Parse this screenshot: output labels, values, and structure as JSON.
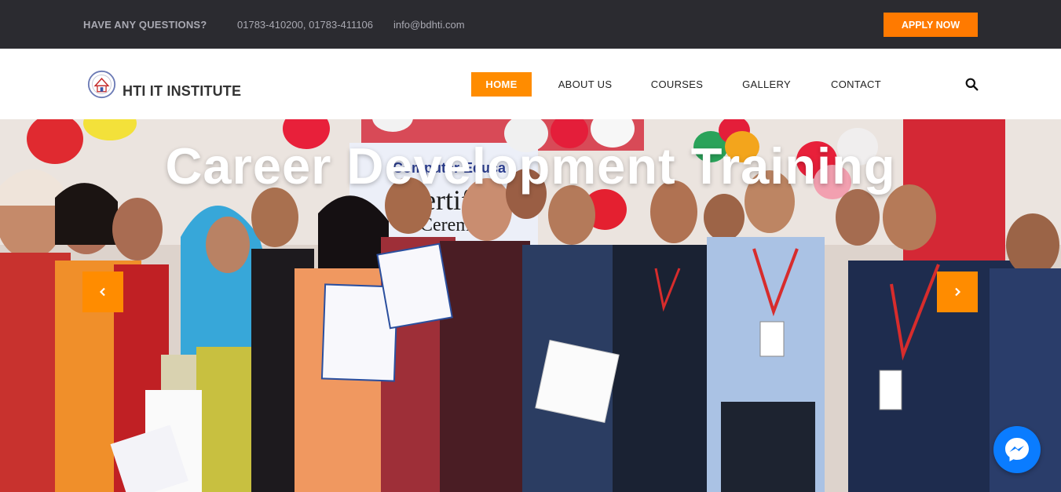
{
  "topbar": {
    "question": "HAVE ANY QUESTIONS?",
    "phones": "01783-410200, 01783-411106",
    "email": "info@bdhti.com",
    "apply_label": "APPLY NOW"
  },
  "header": {
    "brand": "HTI IT INSTITUTE",
    "nav": [
      {
        "label": "HOME",
        "active": true
      },
      {
        "label": "ABOUT US",
        "active": false
      },
      {
        "label": "COURSES",
        "active": false
      },
      {
        "label": "GALLERY",
        "active": false
      },
      {
        "label": "CONTACT",
        "active": false
      }
    ]
  },
  "hero": {
    "title": "Career Development Training",
    "banner_text_1": "Computer Educa",
    "banner_text_2": "Certific",
    "banner_text_3": "Ceremo"
  },
  "colors": {
    "accent": "#ff8c00",
    "topbar_bg": "#2b2b30",
    "messenger": "#0a7cff"
  },
  "icons": {
    "search": "search-icon",
    "prev": "chevron-left-icon",
    "next": "chevron-right-icon",
    "messenger": "messenger-icon"
  }
}
